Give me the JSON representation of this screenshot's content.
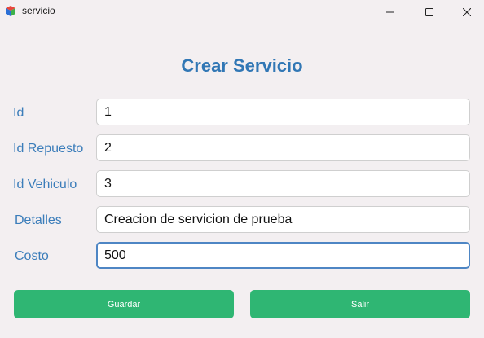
{
  "window": {
    "title": "servicio",
    "icon": "app-cube-icon",
    "controls": [
      "minimize-icon",
      "maximize-icon",
      "close-icon"
    ]
  },
  "form": {
    "title": "Crear Servicio",
    "fields": {
      "id": {
        "label": "Id",
        "value": "1"
      },
      "id_repuesto": {
        "label": "Id Repuesto",
        "value": "2"
      },
      "id_vehiculo": {
        "label": "Id Vehiculo",
        "value": "3"
      },
      "detalles": {
        "label": "Detalles",
        "value": "Creacion de servicion de prueba"
      },
      "costo": {
        "label": "Costo",
        "value": "500"
      }
    },
    "buttons": {
      "guardar": "Guardar",
      "salir": "Salir"
    }
  },
  "colors": {
    "background": "#f3eff1",
    "title": "#3177b5",
    "label": "#3b7dba",
    "button": "#2fb673",
    "focus_border": "#4e86c4"
  }
}
